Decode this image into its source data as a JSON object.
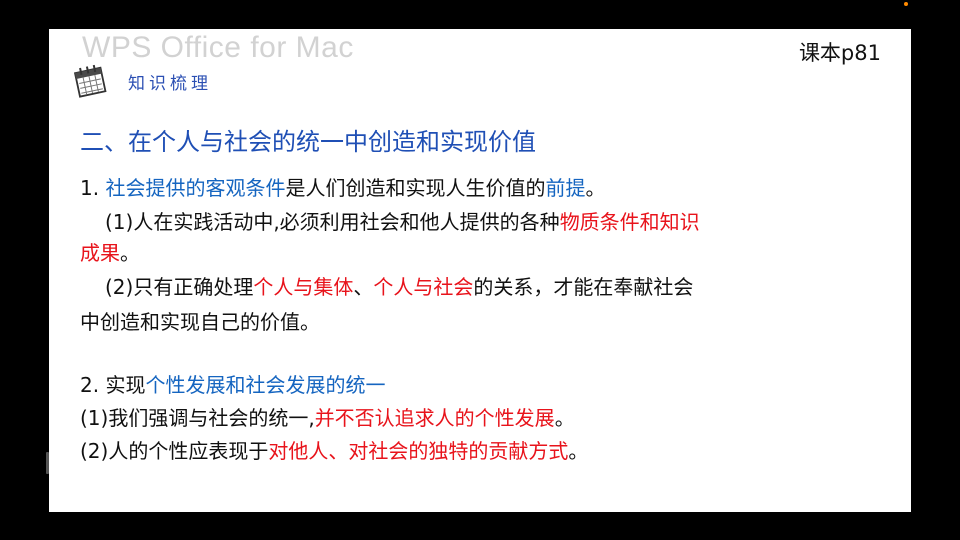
{
  "watermark": "WPS Office for Mac",
  "page_ref": "课本p81",
  "section": {
    "icon": "calendar-icon",
    "label": "知识梳理"
  },
  "heading": "二、在个人与社会的统一中创造和实现价值",
  "point1": {
    "prefix": "1. ",
    "term": "社会提供的客观条件",
    "mid": "是人们创造和实现人生价值的",
    "key": "前提",
    "end": "。"
  },
  "point1_sub1": {
    "prefix": "(1)人在实践活动中,必须利用社会和他人提供的各种",
    "emph_line1": "物质条件和知识",
    "emph_line2": "成果",
    "end": "。"
  },
  "point1_sub2": {
    "prefix": "(2)只有正确处理",
    "emph1": "个人与集体",
    "sep": "、",
    "emph2": "个人与社会",
    "rest_line1": "的关系，才能在奉献社会",
    "rest_line2": "中创造和实现自己的价值。"
  },
  "point2": {
    "prefix": "2. 实现",
    "term": "个性发展和社会发展的统一"
  },
  "point2_sub1": {
    "prefix": "(1)我们强调与社会的统一,",
    "emph": "并不否认追求人的个性发展",
    "end": "。"
  },
  "point2_sub2": {
    "prefix": "(2)人的个性应表现于",
    "emph": "对他人、对社会的独特的贡献方式",
    "end": "。"
  },
  "colors": {
    "heading_blue": "#1f4fb5",
    "term_blue": "#1565c0",
    "emphasis_red": "#e8131b",
    "background": "#000000",
    "slide": "#ffffff"
  }
}
